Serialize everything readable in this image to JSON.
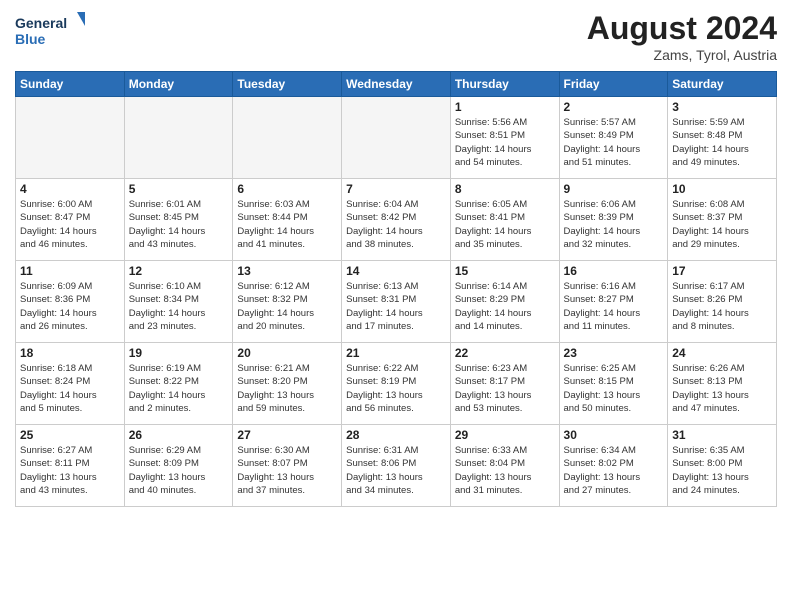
{
  "logo": {
    "line1": "General",
    "line2": "Blue"
  },
  "title": "August 2024",
  "location": "Zams, Tyrol, Austria",
  "weekdays": [
    "Sunday",
    "Monday",
    "Tuesday",
    "Wednesday",
    "Thursday",
    "Friday",
    "Saturday"
  ],
  "weeks": [
    [
      {
        "day": "",
        "info": ""
      },
      {
        "day": "",
        "info": ""
      },
      {
        "day": "",
        "info": ""
      },
      {
        "day": "",
        "info": ""
      },
      {
        "day": "1",
        "info": "Sunrise: 5:56 AM\nSunset: 8:51 PM\nDaylight: 14 hours\nand 54 minutes."
      },
      {
        "day": "2",
        "info": "Sunrise: 5:57 AM\nSunset: 8:49 PM\nDaylight: 14 hours\nand 51 minutes."
      },
      {
        "day": "3",
        "info": "Sunrise: 5:59 AM\nSunset: 8:48 PM\nDaylight: 14 hours\nand 49 minutes."
      }
    ],
    [
      {
        "day": "4",
        "info": "Sunrise: 6:00 AM\nSunset: 8:47 PM\nDaylight: 14 hours\nand 46 minutes."
      },
      {
        "day": "5",
        "info": "Sunrise: 6:01 AM\nSunset: 8:45 PM\nDaylight: 14 hours\nand 43 minutes."
      },
      {
        "day": "6",
        "info": "Sunrise: 6:03 AM\nSunset: 8:44 PM\nDaylight: 14 hours\nand 41 minutes."
      },
      {
        "day": "7",
        "info": "Sunrise: 6:04 AM\nSunset: 8:42 PM\nDaylight: 14 hours\nand 38 minutes."
      },
      {
        "day": "8",
        "info": "Sunrise: 6:05 AM\nSunset: 8:41 PM\nDaylight: 14 hours\nand 35 minutes."
      },
      {
        "day": "9",
        "info": "Sunrise: 6:06 AM\nSunset: 8:39 PM\nDaylight: 14 hours\nand 32 minutes."
      },
      {
        "day": "10",
        "info": "Sunrise: 6:08 AM\nSunset: 8:37 PM\nDaylight: 14 hours\nand 29 minutes."
      }
    ],
    [
      {
        "day": "11",
        "info": "Sunrise: 6:09 AM\nSunset: 8:36 PM\nDaylight: 14 hours\nand 26 minutes."
      },
      {
        "day": "12",
        "info": "Sunrise: 6:10 AM\nSunset: 8:34 PM\nDaylight: 14 hours\nand 23 minutes."
      },
      {
        "day": "13",
        "info": "Sunrise: 6:12 AM\nSunset: 8:32 PM\nDaylight: 14 hours\nand 20 minutes."
      },
      {
        "day": "14",
        "info": "Sunrise: 6:13 AM\nSunset: 8:31 PM\nDaylight: 14 hours\nand 17 minutes."
      },
      {
        "day": "15",
        "info": "Sunrise: 6:14 AM\nSunset: 8:29 PM\nDaylight: 14 hours\nand 14 minutes."
      },
      {
        "day": "16",
        "info": "Sunrise: 6:16 AM\nSunset: 8:27 PM\nDaylight: 14 hours\nand 11 minutes."
      },
      {
        "day": "17",
        "info": "Sunrise: 6:17 AM\nSunset: 8:26 PM\nDaylight: 14 hours\nand 8 minutes."
      }
    ],
    [
      {
        "day": "18",
        "info": "Sunrise: 6:18 AM\nSunset: 8:24 PM\nDaylight: 14 hours\nand 5 minutes."
      },
      {
        "day": "19",
        "info": "Sunrise: 6:19 AM\nSunset: 8:22 PM\nDaylight: 14 hours\nand 2 minutes."
      },
      {
        "day": "20",
        "info": "Sunrise: 6:21 AM\nSunset: 8:20 PM\nDaylight: 13 hours\nand 59 minutes."
      },
      {
        "day": "21",
        "info": "Sunrise: 6:22 AM\nSunset: 8:19 PM\nDaylight: 13 hours\nand 56 minutes."
      },
      {
        "day": "22",
        "info": "Sunrise: 6:23 AM\nSunset: 8:17 PM\nDaylight: 13 hours\nand 53 minutes."
      },
      {
        "day": "23",
        "info": "Sunrise: 6:25 AM\nSunset: 8:15 PM\nDaylight: 13 hours\nand 50 minutes."
      },
      {
        "day": "24",
        "info": "Sunrise: 6:26 AM\nSunset: 8:13 PM\nDaylight: 13 hours\nand 47 minutes."
      }
    ],
    [
      {
        "day": "25",
        "info": "Sunrise: 6:27 AM\nSunset: 8:11 PM\nDaylight: 13 hours\nand 43 minutes."
      },
      {
        "day": "26",
        "info": "Sunrise: 6:29 AM\nSunset: 8:09 PM\nDaylight: 13 hours\nand 40 minutes."
      },
      {
        "day": "27",
        "info": "Sunrise: 6:30 AM\nSunset: 8:07 PM\nDaylight: 13 hours\nand 37 minutes."
      },
      {
        "day": "28",
        "info": "Sunrise: 6:31 AM\nSunset: 8:06 PM\nDaylight: 13 hours\nand 34 minutes."
      },
      {
        "day": "29",
        "info": "Sunrise: 6:33 AM\nSunset: 8:04 PM\nDaylight: 13 hours\nand 31 minutes."
      },
      {
        "day": "30",
        "info": "Sunrise: 6:34 AM\nSunset: 8:02 PM\nDaylight: 13 hours\nand 27 minutes."
      },
      {
        "day": "31",
        "info": "Sunrise: 6:35 AM\nSunset: 8:00 PM\nDaylight: 13 hours\nand 24 minutes."
      }
    ]
  ]
}
